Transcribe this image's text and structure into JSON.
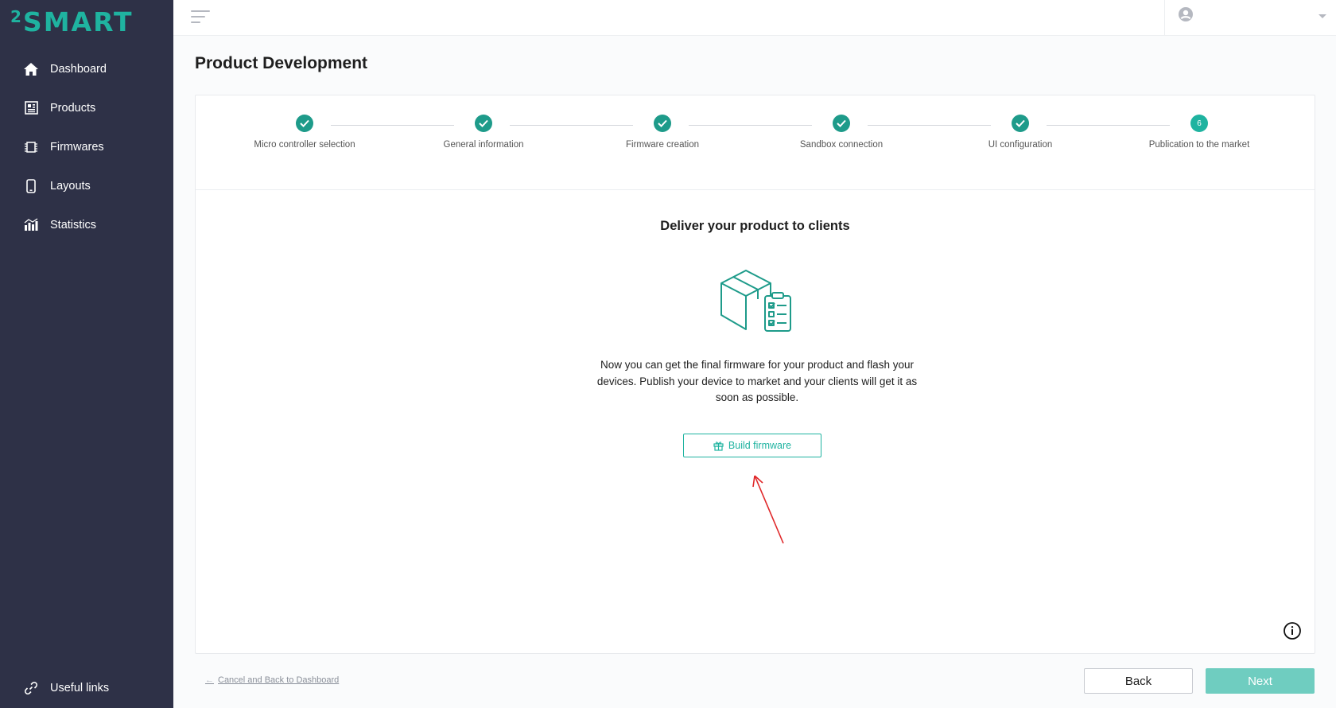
{
  "app": {
    "logo_sup": "2",
    "logo_word": "SMART"
  },
  "sidebar": {
    "items": [
      {
        "label": "Dashboard",
        "icon": "home-icon"
      },
      {
        "label": "Products",
        "icon": "products-icon"
      },
      {
        "label": "Firmwares",
        "icon": "chip-icon"
      },
      {
        "label": "Layouts",
        "icon": "phone-icon"
      },
      {
        "label": "Statistics",
        "icon": "bar-chart-icon"
      }
    ],
    "useful_links": {
      "label": "Useful links",
      "icon": "link-icon"
    }
  },
  "header": {
    "menu_icon": "hamburger-icon",
    "user_icon": "user-icon"
  },
  "page": {
    "title": "Product Development"
  },
  "stepper": {
    "steps": [
      {
        "label": "Micro controller selection",
        "status": "done"
      },
      {
        "label": "General information",
        "status": "done"
      },
      {
        "label": "Firmware creation",
        "status": "done"
      },
      {
        "label": "Sandbox connection",
        "status": "done"
      },
      {
        "label": "UI configuration",
        "status": "done"
      },
      {
        "label": "Publication to the market",
        "status": "current",
        "number": "6"
      }
    ]
  },
  "content": {
    "title": "Deliver your product to clients",
    "description": "Now you can get the final firmware for your product and flash your devices. Publish your device to market and your clients will get it as soon as possible.",
    "build_button": "Build firmware"
  },
  "footer": {
    "cancel_link": "Cancel and Back to Dashboard",
    "back_button": "Back",
    "next_button": "Next"
  },
  "colors": {
    "sidebar_bg": "#2e3147",
    "accent": "#1fb3a0",
    "step_done": "#1e9b8a",
    "next_button": "#6fcdc0",
    "annotation_arrow": "#e0282a"
  }
}
